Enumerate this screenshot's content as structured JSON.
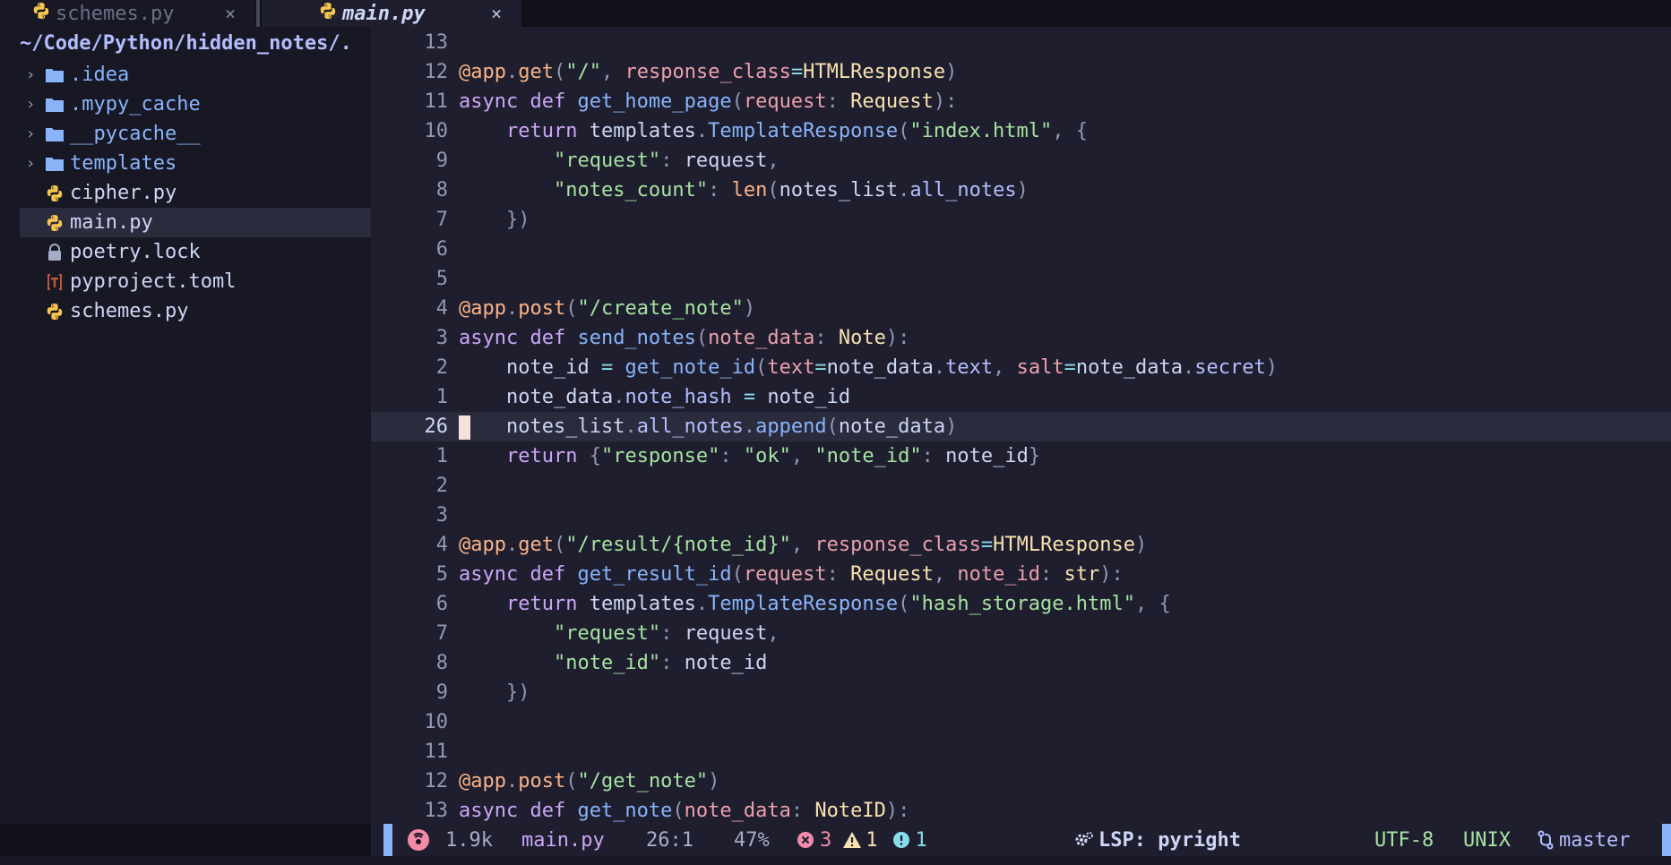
{
  "tabs": [
    {
      "label": "schemes.py",
      "close": "×"
    },
    {
      "label": "main.py",
      "close": "×"
    }
  ],
  "sidebar": {
    "root": "~/Code/Python/hidden_notes/.",
    "items": [
      {
        "label": ".idea",
        "type": "dir",
        "icon": "folder-icon"
      },
      {
        "label": ".mypy_cache",
        "type": "dir",
        "icon": "folder-icon"
      },
      {
        "label": "__pycache__",
        "type": "dir",
        "icon": "folder-icon"
      },
      {
        "label": "templates",
        "type": "dir",
        "icon": "folder-icon"
      },
      {
        "label": "cipher.py",
        "type": "file",
        "icon": "python-icon"
      },
      {
        "label": "main.py",
        "type": "file",
        "icon": "python-icon"
      },
      {
        "label": "poetry.lock",
        "type": "file",
        "icon": "lock-icon"
      },
      {
        "label": "pyproject.toml",
        "type": "file",
        "icon": "toml-icon"
      },
      {
        "label": "schemes.py",
        "type": "file",
        "icon": "python-icon"
      }
    ]
  },
  "editor": {
    "line_numbers": [
      "13",
      "12",
      "11",
      "10",
      "9",
      "8",
      "7",
      "6",
      "5",
      "4",
      "3",
      "2",
      "1",
      "26",
      "1",
      "2",
      "3",
      "4",
      "5",
      "6",
      "7",
      "8",
      "9",
      "10",
      "11",
      "12",
      "13"
    ],
    "current_line": "26"
  },
  "status": {
    "file_size": "1.9k",
    "file_name": "main.py",
    "position": "26:1",
    "percent": "47%",
    "errors": "3",
    "warnings": "1",
    "info": "1",
    "lsp": "LSP: pyright",
    "encoding": "UTF-8",
    "line_ending": "UNIX",
    "branch": "master"
  },
  "colors": {
    "background": "#1e1e2e",
    "sidebar": "#181825",
    "accent": "#89b4fa",
    "error": "#f38ba8",
    "warning": "#f9e2af",
    "info": "#89dceb"
  }
}
